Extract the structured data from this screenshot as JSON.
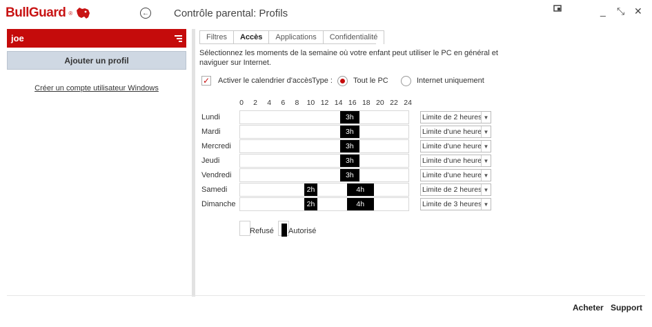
{
  "app": {
    "logo_text": "BullGuard",
    "logo_mark": "®",
    "title": "Contrôle parental: Profils"
  },
  "window_controls": {
    "minimize": "_",
    "restore": "⤡",
    "close": "✕"
  },
  "sidebar": {
    "profile_name": "joe",
    "add_profile_label": "Ajouter un profil",
    "create_account_link": "Créer un compte utilisateur Windows"
  },
  "tabs": [
    {
      "label": "Filtres",
      "active": false
    },
    {
      "label": "Accès",
      "active": true
    },
    {
      "label": "Applications",
      "active": false
    },
    {
      "label": "Confidentialité",
      "active": false
    }
  ],
  "description": "Sélectionnez les moments de la semaine où votre enfant peut utiliser le PC en général et naviguer sur Internet.",
  "calendar": {
    "enable_label": "Activer le calendrier d'accès",
    "enabled": true,
    "type_label": "Type :",
    "options": [
      {
        "label": "Tout le PC",
        "selected": true
      },
      {
        "label": "Internet uniquement",
        "selected": false
      }
    ]
  },
  "hours": [
    "0",
    "2",
    "4",
    "6",
    "8",
    "10",
    "12",
    "14",
    "16",
    "18",
    "20",
    "22",
    "24"
  ],
  "schedule": [
    {
      "day": "Lundi",
      "limit": "Limite de 2 heures",
      "blocks": [
        {
          "start": 14,
          "end": 17,
          "label": "3h"
        }
      ]
    },
    {
      "day": "Mardi",
      "limit": "Limite d'une heure",
      "blocks": [
        {
          "start": 14,
          "end": 17,
          "label": "3h"
        }
      ]
    },
    {
      "day": "Mercredi",
      "limit": "Limite d'une heure",
      "blocks": [
        {
          "start": 14,
          "end": 17,
          "label": "3h"
        }
      ]
    },
    {
      "day": "Jeudi",
      "limit": "Limite d'une heure",
      "blocks": [
        {
          "start": 14,
          "end": 17,
          "label": "3h"
        }
      ]
    },
    {
      "day": "Vendredi",
      "limit": "Limite d'une heure",
      "blocks": [
        {
          "start": 14,
          "end": 17,
          "label": "3h"
        }
      ]
    },
    {
      "day": "Samedi",
      "limit": "Limite de 2 heures",
      "blocks": [
        {
          "start": 9,
          "end": 11,
          "label": "2h"
        },
        {
          "start": 15,
          "end": 19,
          "label": "4h"
        }
      ]
    },
    {
      "day": "Dimanche",
      "limit": "Limite de 3 heures",
      "blocks": [
        {
          "start": 9,
          "end": 11,
          "label": "2h"
        },
        {
          "start": 15,
          "end": 19,
          "label": "4h"
        }
      ]
    }
  ],
  "legend": {
    "denied": "Refusé",
    "allowed": "Autorisé"
  },
  "footer": {
    "buy": "Acheter",
    "support": "Support"
  }
}
